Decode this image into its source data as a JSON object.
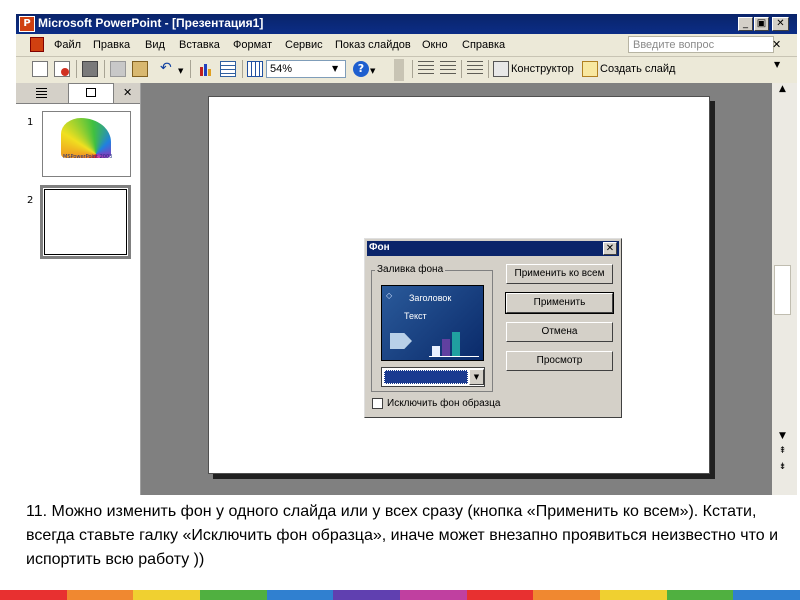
{
  "window": {
    "title": "Microsoft PowerPoint - [Презентация1]",
    "buttons": [
      "_",
      "▣",
      "✕"
    ]
  },
  "menu": {
    "items": [
      "Файл",
      "Правка",
      "Вид",
      "Вставка",
      "Формат",
      "Сервис",
      "Показ слайдов",
      "Окно",
      "Справка"
    ],
    "question_placeholder": "Введите вопрос",
    "close": "✕"
  },
  "toolbar": {
    "zoom": "54%",
    "designer": "Конструктор",
    "new_slide": "Создать слайд"
  },
  "slides_pane": {
    "thumbs": [
      {
        "number": "1",
        "caption": "MSPowerPoint 2003"
      },
      {
        "number": "2"
      }
    ],
    "close": "✕"
  },
  "dialog": {
    "title": "Фон",
    "close": "✕",
    "group_label": "Заливка фона",
    "preview_title": "Заголовок",
    "preview_text": "Текст",
    "apply_all": "Применить ко всем",
    "apply": "Применить",
    "cancel": "Отмена",
    "preview": "Просмотр",
    "checkbox_label": "Исключить фон образца"
  },
  "caption": "11.   Можно изменить фон у одного слайда или у всех сразу (кнопка «Применить ко всем»). Кстати, всегда ставьте галку «Исключить фон образца», иначе может внезапно проявиться неизвестно что и испортить всю работу ))",
  "colors": {
    "titlebar": "#0a246a",
    "workspace": "#808080",
    "dialog": "#d4d0c8"
  }
}
